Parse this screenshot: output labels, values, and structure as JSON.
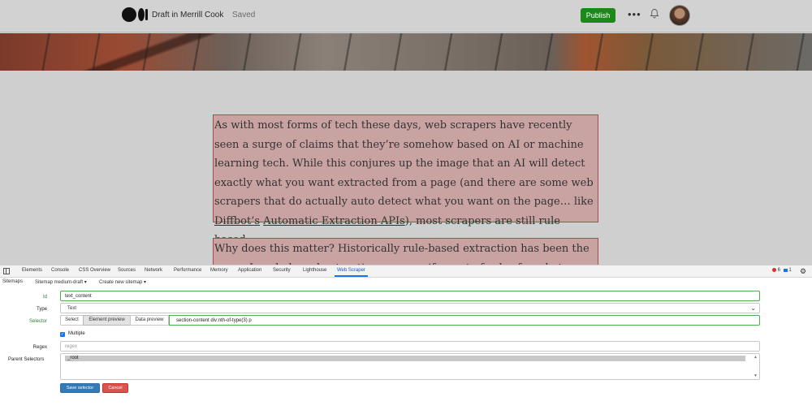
{
  "editor": {
    "draft_label": "Draft in Merrill Cook",
    "saved_label": "Saved",
    "publish_label": "Publish",
    "more_icon": "•••"
  },
  "article": {
    "para1": {
      "pre": "As with most forms of tech these days, web scrapers have recently seen a surge of claims that they’re somehow based on AI or machine learning tech. While this conjures up the image that an AI will detect exactly what you want extracted from a page (and there are some web scrapers that do actually auto detect what you want on the page… like ",
      "link1": "Diffbot’s",
      "link2": "Automatic Extraction APIs",
      "post": "), most scrapers are still rule based."
    },
    "para2": "Why does this matter? Historically rule-based extraction has been the norm. In rule-based extraction you specify a set of rules for what you want pulled"
  },
  "devtools": {
    "tabs": [
      "Elements",
      "Console",
      "CSS Overview",
      "Sources",
      "Network",
      "Performance",
      "Memory",
      "Application",
      "Security",
      "Lighthouse",
      "Web Scraper"
    ],
    "active_tab": "Web Scraper",
    "error_count": "6",
    "message_count": "1",
    "settings_icon": "⚙"
  },
  "scraper": {
    "nav": {
      "sitemaps": "Sitemaps",
      "current_sitemap": "Sitemap medium-draft ▾",
      "create": "Create new sitemap ▾"
    },
    "form": {
      "id_label": "Id",
      "id_value": "text_content",
      "type_label": "Type",
      "type_value": "Text",
      "selector_label": "Selector",
      "select_btn": "Select",
      "element_preview_btn": "Element preview",
      "data_preview_btn": "Data preview",
      "selector_value": "section-content div:nth-of-type(3) p",
      "multiple_label": "Multiple",
      "multiple_checked": true,
      "regex_label": "Regex",
      "regex_placeholder": "regex",
      "parent_label": "Parent Selectors",
      "parent_options": [
        "_root"
      ],
      "save_btn": "Save selector",
      "cancel_btn": "Cancel"
    }
  }
}
